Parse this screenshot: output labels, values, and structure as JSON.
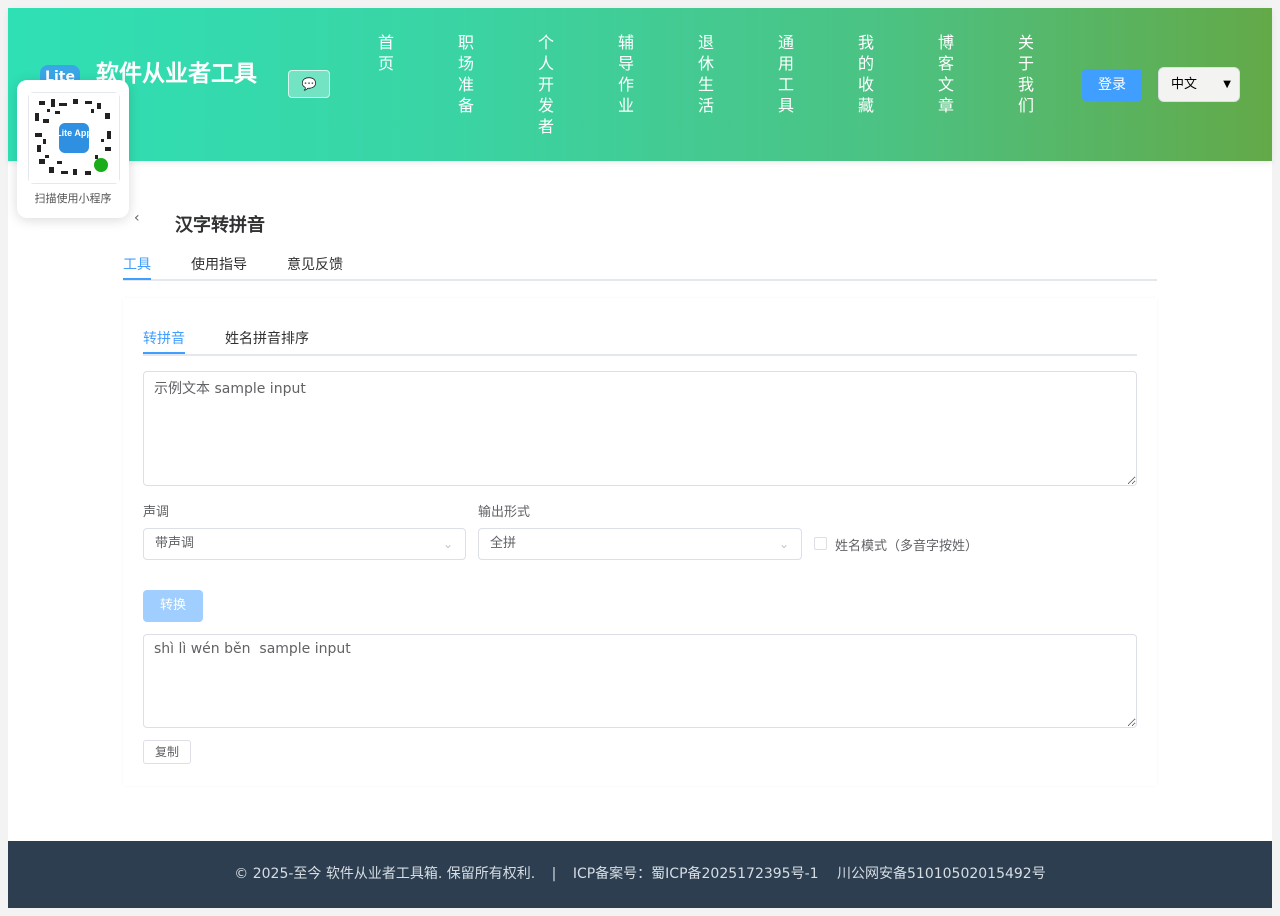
{
  "header": {
    "logo_text": "Lite",
    "title": "软件从业者工具",
    "nav": [
      "首页",
      "职场准备",
      "个人开发者",
      "辅导作业",
      "退休生活",
      "通用工具",
      "我的收藏",
      "博客文章",
      "关于我们"
    ],
    "login_label": "登录",
    "language": "中文",
    "chat_icon": "chat-bubble-icon"
  },
  "qr": {
    "caption": "扫描使用小程序",
    "badge_text": "Lite App"
  },
  "page": {
    "title": "汉字转拼音",
    "tabs": [
      "工具",
      "使用指导",
      "意见反馈"
    ],
    "active_tab": 0
  },
  "tool": {
    "subtabs": [
      "转拼音",
      "姓名拼音排序"
    ],
    "input_text": "示例文本 sample input",
    "tone_label": "声调",
    "tone_value": "带声调",
    "format_label": "输出形式",
    "format_value": "全拼",
    "name_mode_label": "姓名模式（多音字按姓）",
    "name_mode_checked": false,
    "convert_label": "转换",
    "output_text": "shì lì wén běn  sample input",
    "copy_label": "复制"
  },
  "footer": {
    "copyright": "© 2025-至今 软件从业者工具箱. 保留所有权利.",
    "separator": "|",
    "icp": "ICP备案号：蜀ICP备2025172395号-1",
    "police": "川公网安备51010502015492号"
  },
  "colors": {
    "accent": "#409eff",
    "header_gradient_start": "#2fe0b5",
    "header_gradient_end": "#63a948",
    "footer_bg": "#2c3e50"
  }
}
